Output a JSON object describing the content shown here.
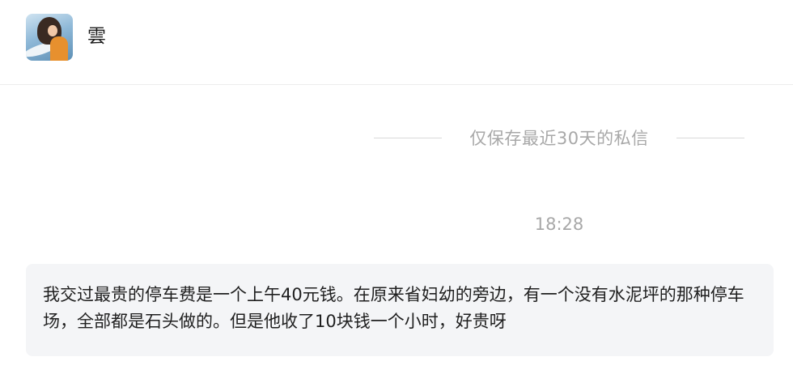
{
  "contact": {
    "name": "雲",
    "avatar_icon": "user-avatar-photo"
  },
  "notice": {
    "text": "仅保存最近30天的私信"
  },
  "messages": [
    {
      "time": "18:28",
      "text": "我交过最贵的停车费是一个上午40元钱。在原来省妇幼的旁边，有一个没有水泥坪的那种停车场，全部都是石头做的。但是他收了10块钱一个小时，好贵呀"
    }
  ],
  "colors": {
    "background": "#ffffff",
    "bubble": "#f4f5f7",
    "muted_text": "#a8a8a8",
    "divider": "#d9d9d9"
  }
}
